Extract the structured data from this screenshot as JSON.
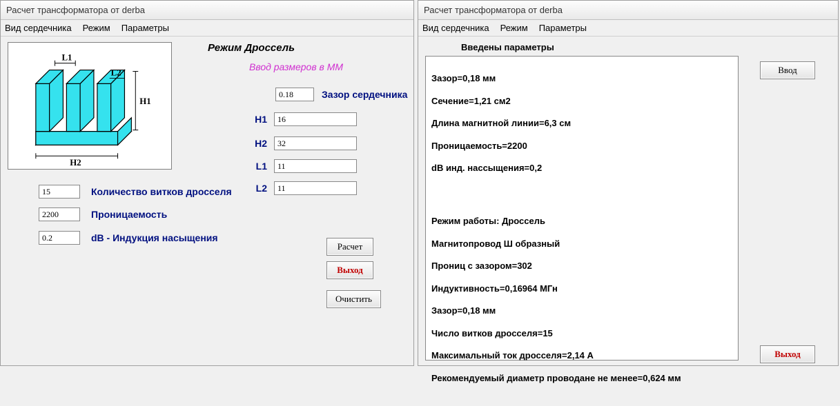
{
  "left": {
    "title": "Расчет трансформатора от derba",
    "menu": {
      "core": "Вид сердечника",
      "mode": "Режим",
      "params": "Параметры"
    },
    "heading": "Режим Дроссель",
    "subheading": "Ввод размеров в ММ",
    "labels": {
      "gap": "Зазор сердечника",
      "H1": "H1",
      "H2": "H2",
      "L1": "L1",
      "L2": "L2",
      "turns": "Количество витков дросселя",
      "perm": "Проницаемость",
      "db": "dB - Индукция насыщения"
    },
    "values": {
      "gap": "0.18",
      "H1": "16",
      "H2": "32",
      "L1": "11",
      "L2": "11",
      "turns": "15",
      "perm": "2200",
      "db": "0.2"
    },
    "buttons": {
      "calc": "Расчет",
      "exit": "Выход",
      "clear": "Очистить"
    },
    "diagram": {
      "L1": "L1",
      "L2": "L2",
      "H1": "H1",
      "H2": "H2"
    }
  },
  "right": {
    "title": "Расчет трансформатора от derba",
    "menu": {
      "core": "Вид сердечника",
      "mode": "Режим",
      "params": "Параметры"
    },
    "params_title": "Введены параметры",
    "block1": {
      "l1": "Зазор=0,18 мм",
      "l2": "Сечение=1,21 см2",
      "l3": "Длина магнитной линии=6,3 см",
      "l4": "Проницаемость=2200",
      "l5": "dB инд. нассыщения=0,2"
    },
    "block2": {
      "l1": "          Режим работы: Дроссель",
      "l2": "Магнитопровод Ш образный",
      "l3": "Прониц с зазором=302",
      "l4": "Индуктивность=0,16964 МГн",
      "l5": "Зазор=0,18 мм",
      "l6": "Число витков дросселя=15",
      "l7": "Максимальный ток дросселя=2,14 А",
      "l8": "Рекомендуемый диаметр проводане не менее=0,624 мм"
    },
    "buttons": {
      "vvod": "Ввод",
      "exit": "Выход"
    }
  }
}
